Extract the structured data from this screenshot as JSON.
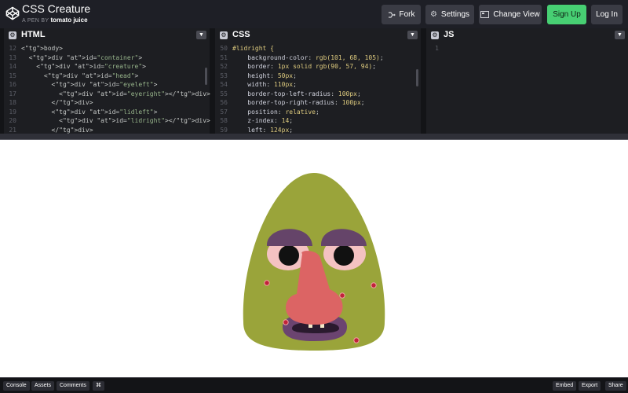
{
  "header": {
    "title": "CSS Creature",
    "byline_prefix": "A PEN BY",
    "author": "tomato juice",
    "fork_label": "Fork",
    "settings_label": "Settings",
    "change_view_label": "Change View",
    "signup_label": "Sign Up",
    "login_label": "Log In"
  },
  "panels": {
    "html": {
      "title": "HTML",
      "lines": [
        {
          "n": "12",
          "t": "<body>"
        },
        {
          "n": "13",
          "t": "  <div id=\"container\">"
        },
        {
          "n": "14",
          "t": "    <div id=\"creature\">"
        },
        {
          "n": "15",
          "t": "      <div id=\"head\">"
        },
        {
          "n": "16",
          "t": "        <div id=\"eyeleft\">"
        },
        {
          "n": "17",
          "t": "          <div id=\"eyeright\"></div>"
        },
        {
          "n": "18",
          "t": "        </div>"
        },
        {
          "n": "19",
          "t": "        <div id=\"lidleft\">"
        },
        {
          "n": "20",
          "t": "          <div id=\"lidright\"></div>"
        },
        {
          "n": "21",
          "t": "        </div>"
        }
      ]
    },
    "css": {
      "title": "CSS",
      "lines": [
        {
          "n": "50",
          "t": "#lidright {"
        },
        {
          "n": "51",
          "t": "    background-color: rgb(101, 68, 105);"
        },
        {
          "n": "52",
          "t": "    border: 1px solid rgb(90, 57, 94);"
        },
        {
          "n": "53",
          "t": "    height: 50px;"
        },
        {
          "n": "54",
          "t": "    width: 110px;"
        },
        {
          "n": "55",
          "t": "    border-top-left-radius: 100px;"
        },
        {
          "n": "56",
          "t": "    border-top-right-radius: 100px;"
        },
        {
          "n": "57",
          "t": "    position: relative;"
        },
        {
          "n": "58",
          "t": "    z-index: 14;"
        },
        {
          "n": "59",
          "t": "    left: 124px;"
        }
      ]
    },
    "js": {
      "title": "JS",
      "lines": [
        {
          "n": "1",
          "t": ""
        }
      ]
    }
  },
  "footer": {
    "console_label": "Console",
    "assets_label": "Assets",
    "comments_label": "Comments",
    "shortcut_label": "⌘",
    "embed_label": "Embed",
    "export_label": "Export",
    "share_label": "Share"
  },
  "colors": {
    "header_bg": "#1e1f26",
    "signup_bg": "#47cf73",
    "creature_skin": "#9aa43a",
    "eyelid": "#654469",
    "nose": "#dc6464",
    "mouth": "#5f3d64"
  }
}
